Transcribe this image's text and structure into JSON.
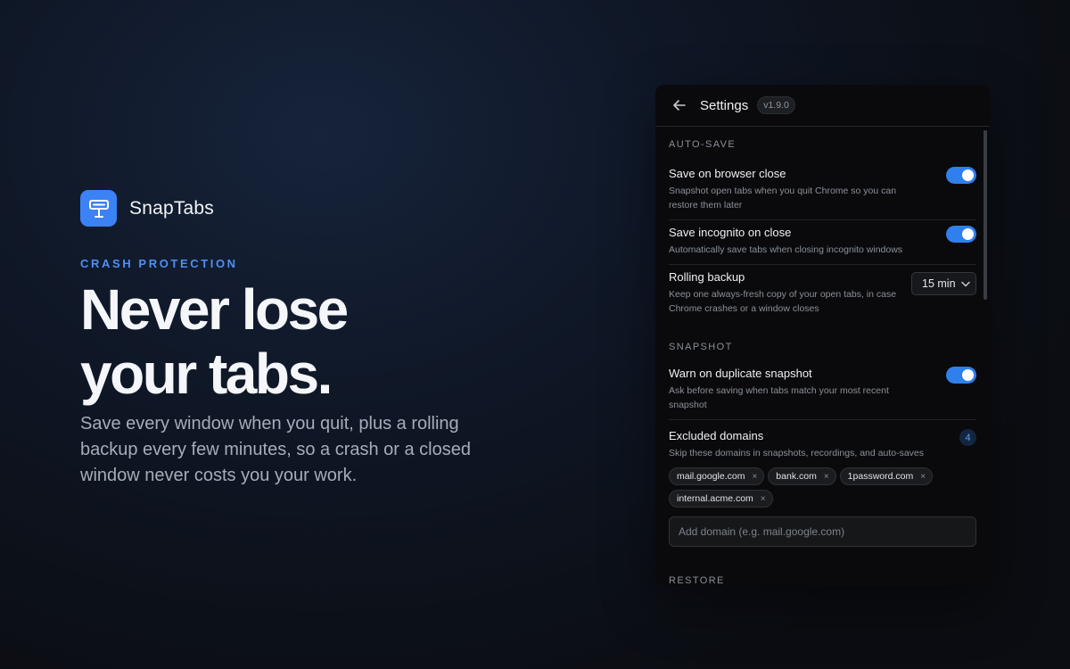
{
  "brand": {
    "name": "SnapTabs",
    "logo_icon": "sign-icon",
    "accent": "#3b82f6"
  },
  "hero": {
    "eyebrow": "CRASH PROTECTION",
    "headline_line1": "Never lose",
    "headline_line2": "your tabs.",
    "subtext": "Save every window when you quit, plus a rolling backup every few minutes, so a crash or a closed window never costs you your work."
  },
  "panel": {
    "title": "Settings",
    "version": "v1.9.0",
    "sections": {
      "auto_save": {
        "label": "AUTO-SAVE",
        "save_on_close": {
          "title": "Save on browser close",
          "desc": "Snapshot open tabs when you quit Chrome so you can restore them later",
          "enabled": true
        },
        "save_incognito": {
          "title": "Save incognito on close",
          "desc": "Automatically save tabs when closing incognito windows",
          "enabled": true
        },
        "rolling_backup": {
          "title": "Rolling backup",
          "desc": "Keep one always-fresh copy of your open tabs, in case Chrome crashes or a window closes",
          "value": "15 min"
        }
      },
      "snapshot": {
        "label": "SNAPSHOT",
        "warn_duplicate": {
          "title": "Warn on duplicate snapshot",
          "desc": "Ask before saving when tabs match your most recent snapshot",
          "enabled": true
        },
        "excluded_domains": {
          "title": "Excluded domains",
          "desc": "Skip these domains in snapshots, recordings, and auto-saves",
          "count": "4",
          "domains": [
            "mail.google.com",
            "bank.com",
            "1password.com",
            "internal.acme.com"
          ],
          "remove_glyph": "×",
          "input_placeholder": "Add domain (e.g. mail.google.com)"
        }
      },
      "restore": {
        "label": "RESTORE"
      }
    }
  }
}
